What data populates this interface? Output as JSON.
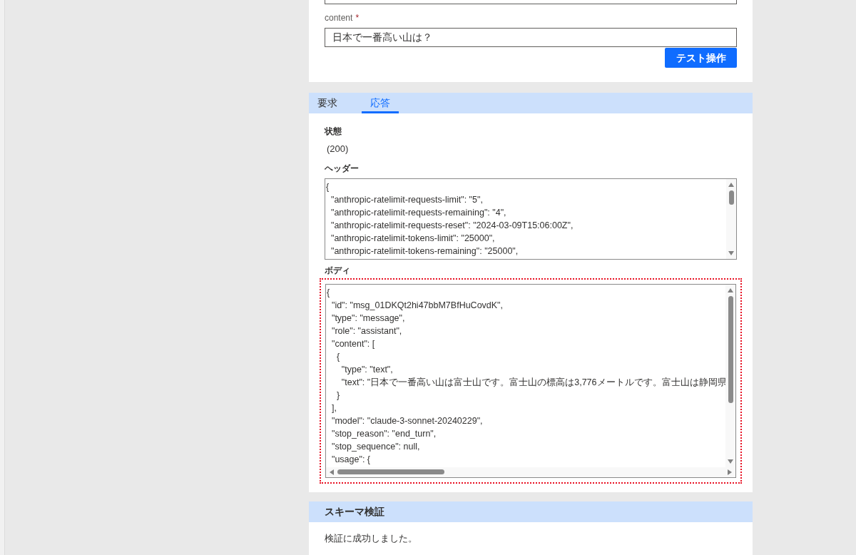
{
  "top_form": {
    "fields": [
      {
        "label": "content",
        "required_mark": "*",
        "value": "日本で一番高い山は？"
      }
    ],
    "button": "テスト操作"
  },
  "tabs": [
    {
      "label": "要求",
      "selected": false
    },
    {
      "label": "応答",
      "selected": true
    }
  ],
  "response": {
    "status": {
      "label": "状態",
      "value": "(200)"
    },
    "headers": {
      "label": "ヘッダー",
      "lines": [
        "{",
        "  \"anthropic-ratelimit-requests-limit\": \"5\",",
        "  \"anthropic-ratelimit-requests-remaining\": \"4\",",
        "  \"anthropic-ratelimit-requests-reset\": \"2024-03-09T15:06:00Z\",",
        "  \"anthropic-ratelimit-tokens-limit\": \"25000\",",
        "  \"anthropic-ratelimit-tokens-remaining\": \"25000\","
      ]
    },
    "body": {
      "label": "ボディ",
      "focused": true,
      "lines": [
        "{",
        "  \"id\": \"msg_01DKQt2hi47bbM7BfHuCovdK\",",
        "  \"type\": \"message\",",
        "  \"role\": \"assistant\",",
        "  \"content\": [",
        "    {",
        "      \"type\": \"text\",",
        "      \"text\": \"日本で一番高い山は富士山です。富士山の標高は3,776メートルです。富士山は静岡県",
        "    }",
        "  ],",
        "  \"model\": \"claude-3-sonnet-20240229\",",
        "  \"stop_reason\": \"end_turn\",",
        "  \"stop_sequence\": null,",
        "  \"usage\": {"
      ]
    }
  },
  "schema": {
    "title": "スキーマ検証",
    "message": "検証に成功しました。"
  }
}
